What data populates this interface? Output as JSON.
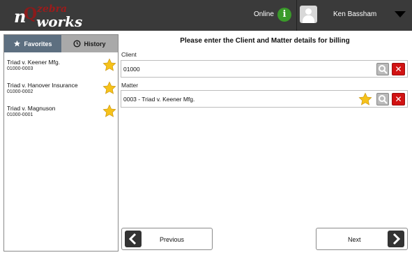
{
  "header": {
    "logo_n": "n",
    "logo_zebra": "zebra",
    "logo_works": "works",
    "status_text": "Online",
    "user_name": "Ken Bassham"
  },
  "tabs": {
    "favorites_label": "Favorites",
    "history_label": "History",
    "active": "Favorites"
  },
  "favorites": [
    {
      "name": "Triad v. Keener Mfg.",
      "code": "01000-0003"
    },
    {
      "name": "Triad v. Hanover Insurance",
      "code": "01000-0002"
    },
    {
      "name": "Triad v. Magnuson",
      "code": "01000-0001"
    }
  ],
  "main": {
    "title": "Please enter the Client and Matter details for billing",
    "client_label": "Client",
    "client_value": "01000",
    "matter_label": "Matter",
    "matter_value": "0003 - Triad v. Keener Mfg."
  },
  "nav": {
    "previous_label": "Previous",
    "next_label": "Next"
  },
  "colors": {
    "header_bg": "#3a3a3a",
    "tab_active": "#5d6f80",
    "tab_inactive": "#a9a9a9",
    "clear_red": "#d11212",
    "status_green": "#3a9a2a",
    "star_gold": "#f6c21a"
  }
}
